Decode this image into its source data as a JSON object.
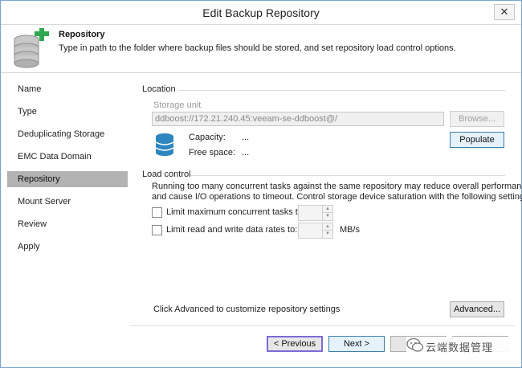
{
  "window": {
    "title": "Edit Backup Repository",
    "close_glyph": "✕"
  },
  "header": {
    "icon": "database-add-icon",
    "title": "Repository",
    "description": "Type in path to the folder where backup files should be stored, and set repository load control options."
  },
  "sidebar": {
    "items": [
      {
        "label": "Name",
        "active": false
      },
      {
        "label": "Type",
        "active": false
      },
      {
        "label": "Deduplicating Storage",
        "active": false
      },
      {
        "label": "EMC Data Domain",
        "active": false
      },
      {
        "label": "Repository",
        "active": true
      },
      {
        "label": "Mount Server",
        "active": false
      },
      {
        "label": "Review",
        "active": false
      },
      {
        "label": "Apply",
        "active": false
      }
    ]
  },
  "location": {
    "group_title": "Location",
    "storage_unit_label": "Storage unit",
    "storage_unit_value": "ddboost://172.21.240.45:veeam-se-ddboost@/",
    "browse_label": "Browse...",
    "capacity_label": "Capacity:",
    "capacity_value": "...",
    "free_space_label": "Free space:",
    "free_space_value": "...",
    "populate_label": "Populate"
  },
  "load_control": {
    "group_title": "Load control",
    "description_line1": "Running too many concurrent tasks against the same repository may reduce overall performance,",
    "description_line2": "and cause I/O operations to timeout. Control storage device saturation with the following settings:",
    "limit_tasks_label": "Limit maximum concurrent tasks to:",
    "limit_tasks_checked": false,
    "limit_rate_label": "Limit read and write data rates to:",
    "limit_rate_checked": false,
    "rate_unit": "MB/s"
  },
  "advanced": {
    "hint": "Click Advanced to customize repository settings",
    "button_label": "Advanced..."
  },
  "footer": {
    "previous_label": "< Previous",
    "next_label": "Next >",
    "watermark_text": "云端数据管理"
  },
  "colors": {
    "accent": "#3c7fb1",
    "active_nav": "#b3b3b3",
    "db_blue": "#2e86c1",
    "plus_green": "#2fa84f"
  }
}
